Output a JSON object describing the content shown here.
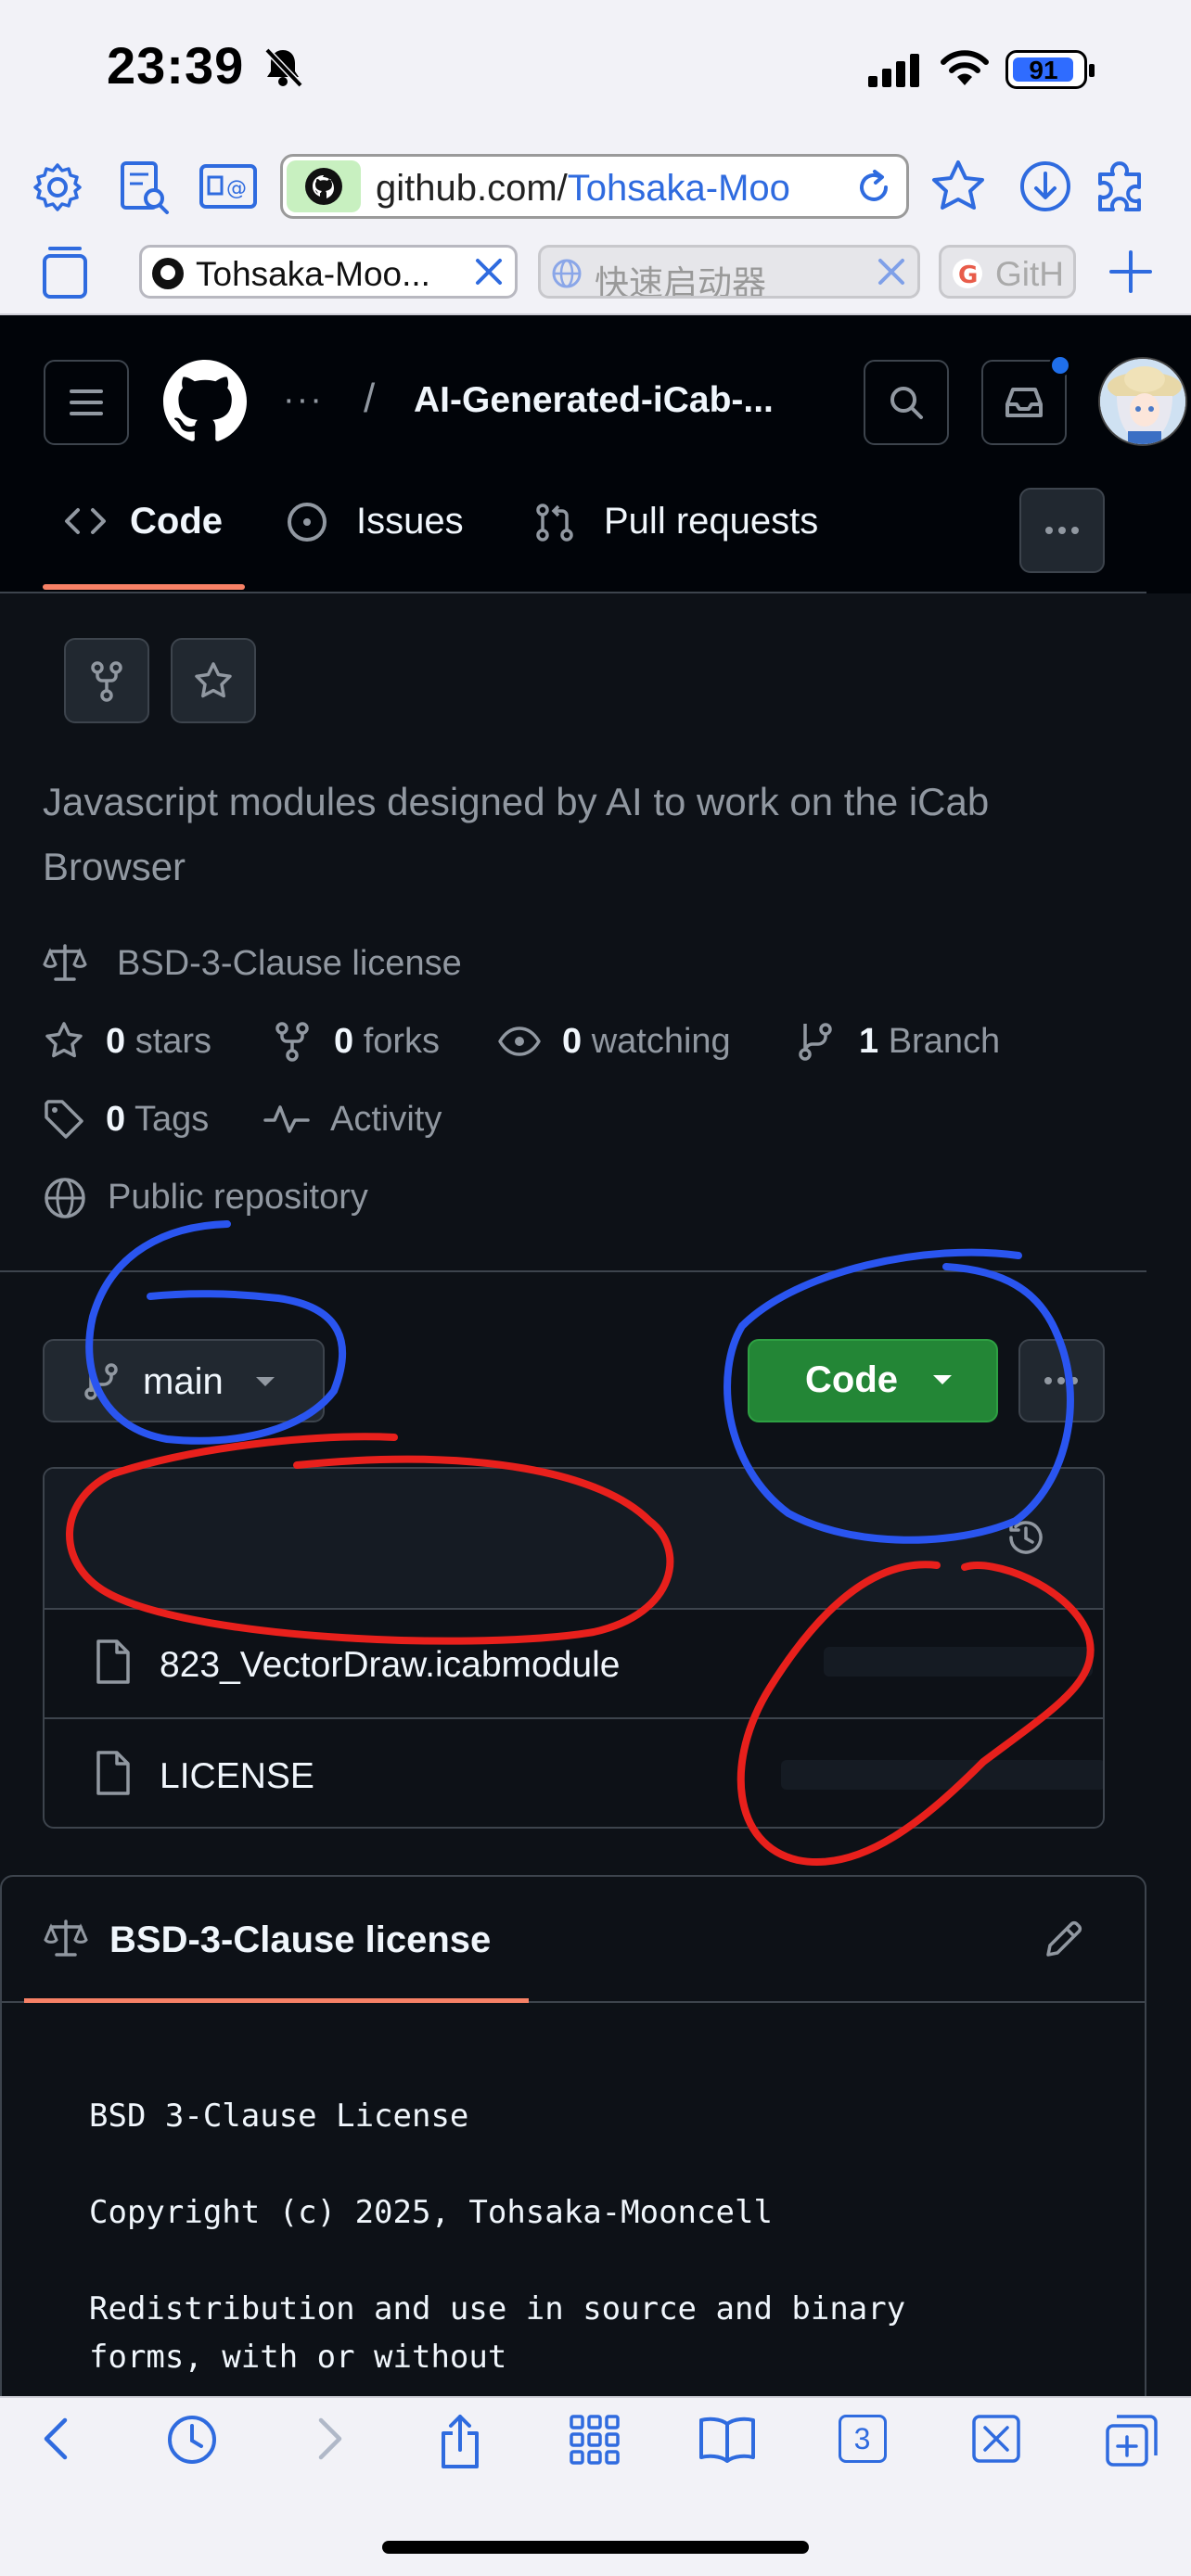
{
  "status_bar": {
    "time": "23:39",
    "battery": "91"
  },
  "browser": {
    "url_prefix": "github.com/",
    "url_path": "Tohsaka-Moo",
    "tabs": [
      {
        "label": "Tohsaka-Moo..."
      },
      {
        "label": "快速启动器"
      },
      {
        "label": "GitH"
      }
    ]
  },
  "header": {
    "breadcrumb_dots": "···",
    "separator": "/",
    "repo_name": "AI-Generated-iCab-..."
  },
  "repo_nav": {
    "code": "Code",
    "issues": "Issues",
    "pulls": "Pull requests"
  },
  "repo": {
    "description": "Javascript modules designed by AI to work on the iCab Browser",
    "license": "BSD-3-Clause license",
    "stars_count": "0",
    "stars_label": "stars",
    "forks_count": "0",
    "forks_label": "forks",
    "watching_count": "0",
    "watching_label": "watching",
    "branch_count": "1",
    "branch_label": "Branch",
    "tags_count": "0",
    "tags_label": "Tags",
    "activity": "Activity",
    "visibility": "Public repository"
  },
  "branch_selector": {
    "label": "main"
  },
  "code_button": {
    "label": "Code"
  },
  "files": [
    {
      "name": "823_VectorDraw.icabmodule"
    },
    {
      "name": "LICENSE"
    }
  ],
  "license_panel": {
    "title": "BSD-3-Clause license",
    "lines": [
      "BSD 3-Clause License",
      "Copyright (c) 2025, Tohsaka-Mooncell",
      "Redistribution and use in source and binary",
      "forms, with or without"
    ]
  },
  "bottom_bar": {
    "tab_count": "3"
  },
  "colors": {
    "accent_underline": "#f78166",
    "code_button": "#238636",
    "link_blue": "#2f6bdf",
    "annotation_blue": "#2a55f0",
    "annotation_red": "#e8201c"
  }
}
